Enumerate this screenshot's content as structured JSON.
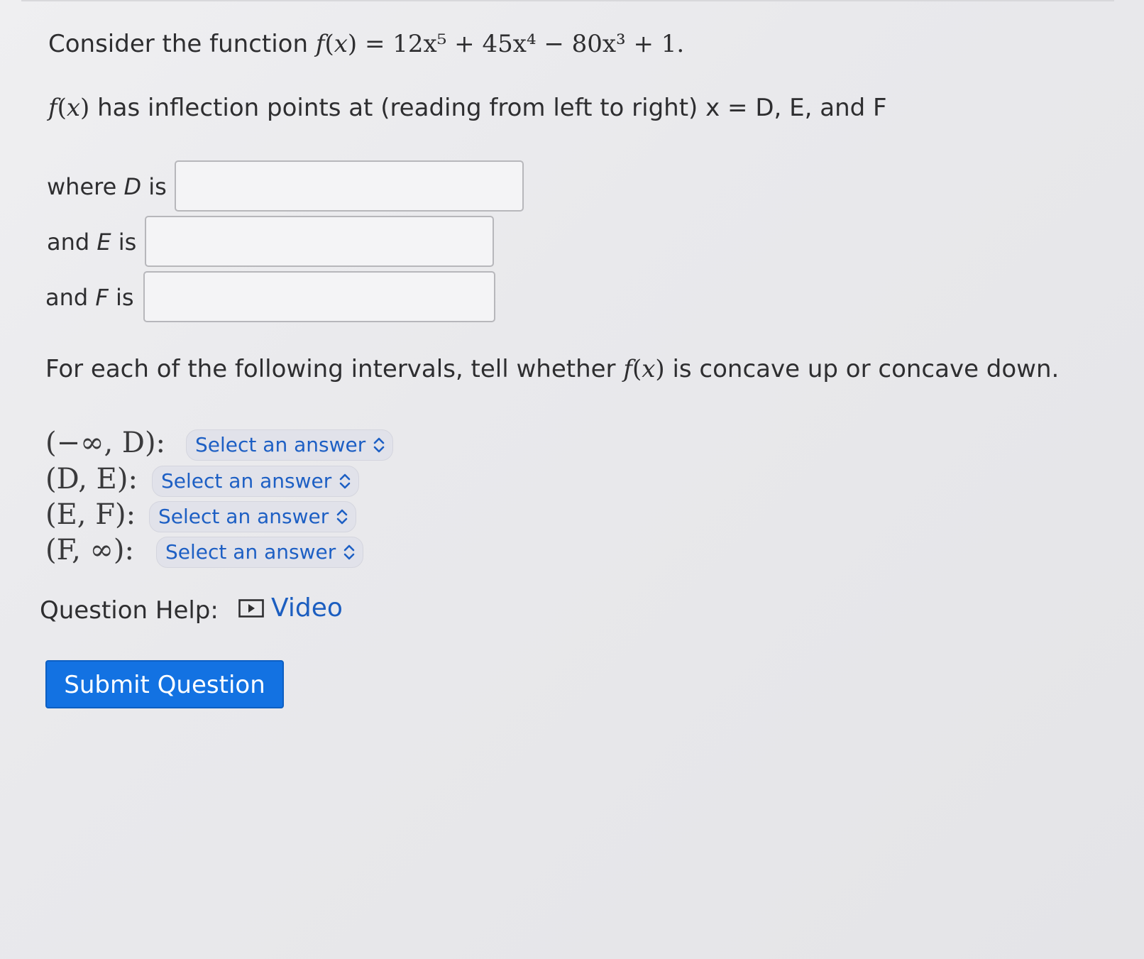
{
  "question": {
    "line1_prefix": "Consider the function ",
    "function_lhs": "f",
    "function_var": "x",
    "function_rhs": "12x⁵ + 45x⁴ − 80x³ + 1.",
    "line2_suffix": " has inflection points at (reading from left to right) x = D, E, and F"
  },
  "answers": [
    {
      "label_prefix": "where ",
      "var": "D",
      "label_suffix": " is",
      "value": ""
    },
    {
      "label_prefix": "and ",
      "var": "E",
      "label_suffix": " is",
      "value": ""
    },
    {
      "label_prefix": "and ",
      "var": "F",
      "label_suffix": " is",
      "value": ""
    }
  ],
  "intervals": {
    "intro_prefix": "For each of the following intervals, tell whether ",
    "intro_suffix": " is concave up or concave down.",
    "rows": [
      {
        "interval": "(−∞, D):",
        "select": "Select an answer"
      },
      {
        "interval": "(D, E):",
        "select": "Select an answer"
      },
      {
        "interval": "(E, F):",
        "select": "Select an answer"
      },
      {
        "interval": "(F, ∞):",
        "select": "Select an answer"
      }
    ]
  },
  "help": {
    "label": "Question Help:",
    "video": "Video",
    "icon": "play-icon"
  },
  "submit": {
    "label": "Submit Question"
  },
  "colors": {
    "accent": "#1372e2",
    "link": "#1c5ec0",
    "select_bg": "#e1e2ea"
  }
}
